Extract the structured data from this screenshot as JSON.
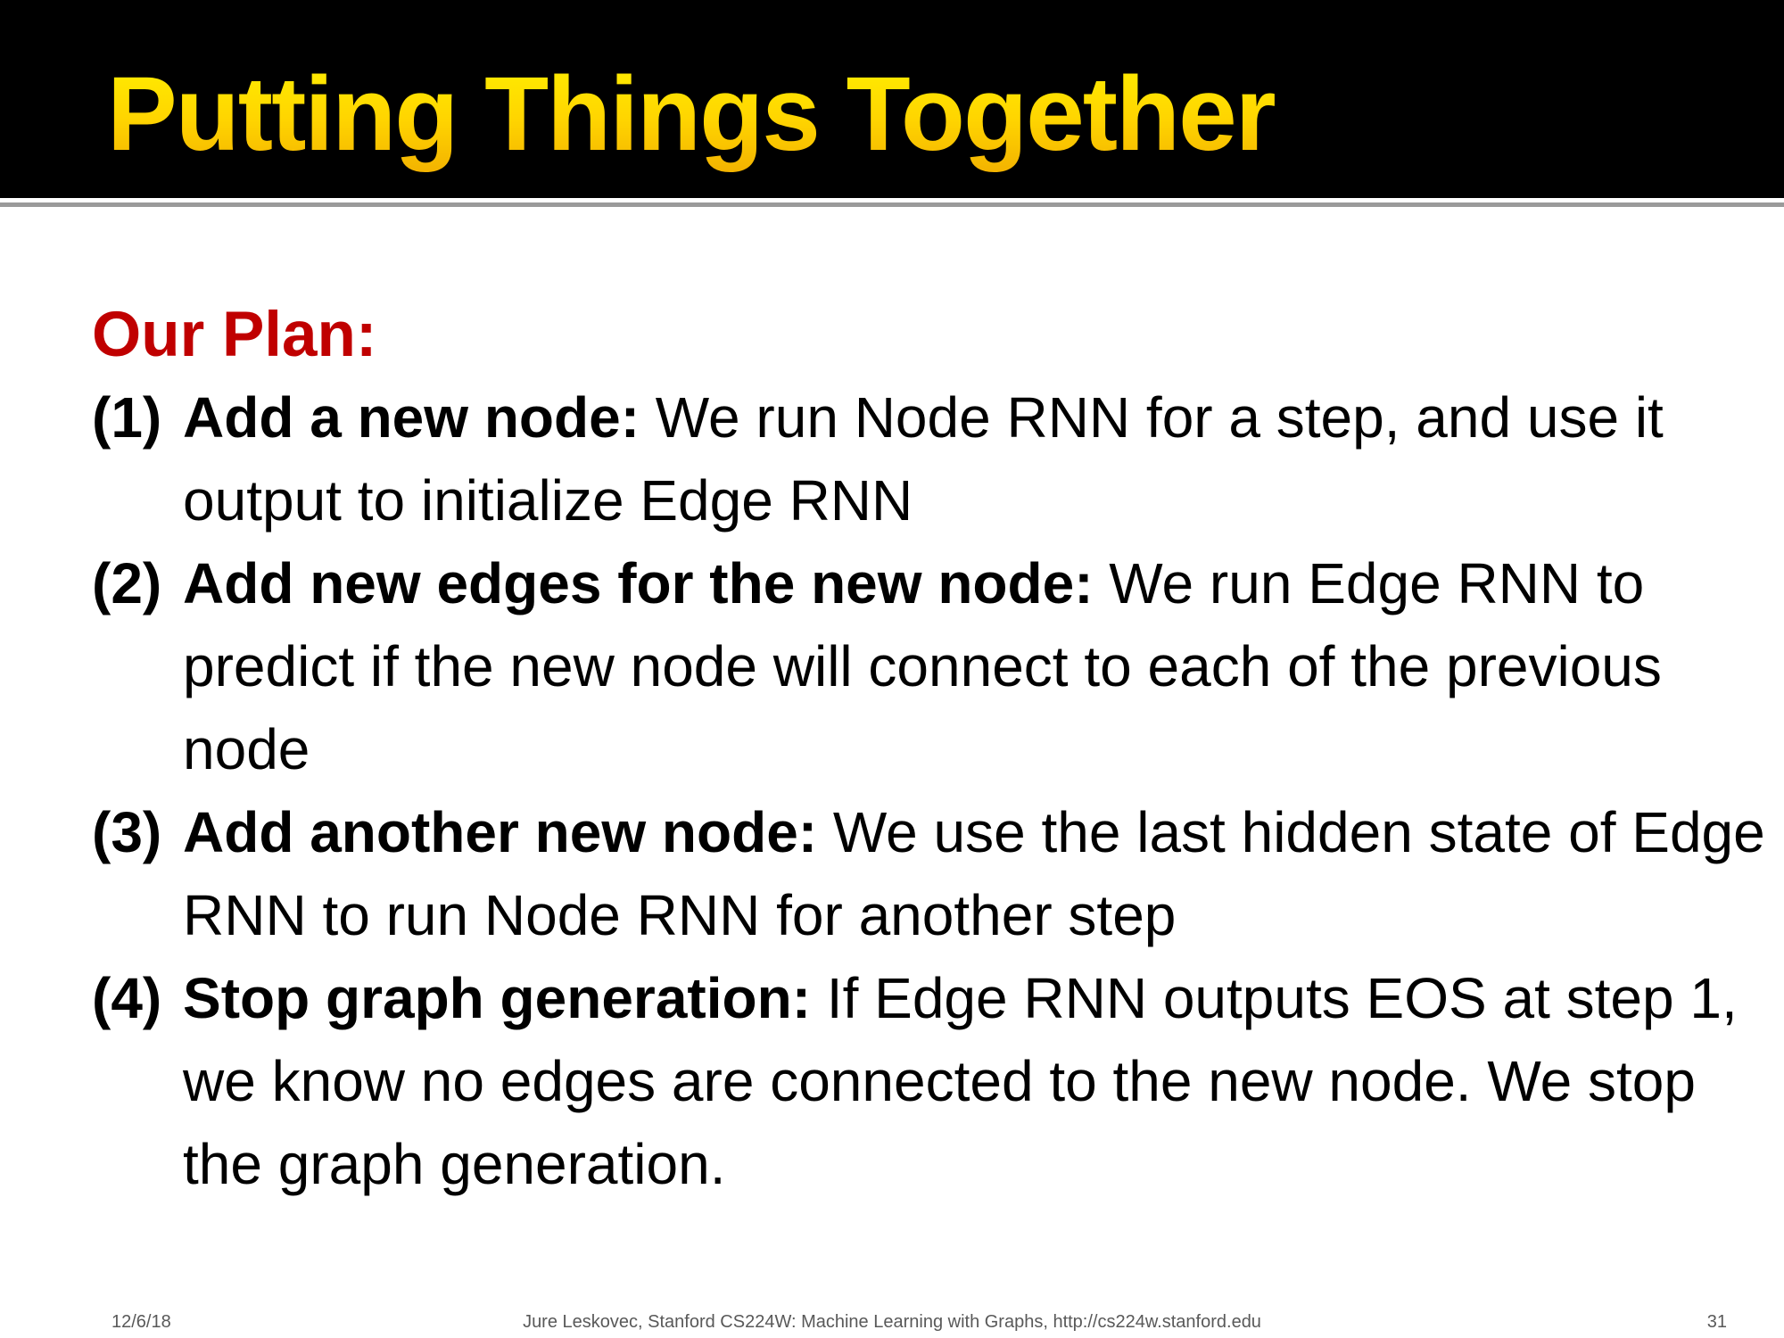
{
  "slide": {
    "title": "Putting Things Together",
    "heading": "Our Plan:",
    "steps": [
      {
        "number": "(1)",
        "lead": "Add a new node:",
        "text": " We run Node RNN for a step, and use it output to initialize Edge RNN"
      },
      {
        "number": "(2)",
        "lead": "Add new edges for the new node:",
        "text": " We run Edge RNN to predict if the new node will connect to each of the previous node"
      },
      {
        "number": "(3)",
        "lead": "Add another new node:",
        "text": " We use the last hidden state of Edge RNN to run Node RNN for another step"
      },
      {
        "number": "(4)",
        "lead": "Stop graph generation:",
        "text": " If Edge RNN outputs EOS at step 1, we know no edges are connected to the new node. We stop the graph generation."
      }
    ]
  },
  "footer": {
    "date": "12/6/18",
    "credit": "Jure Leskovec, Stanford CS224W: Machine Learning with Graphs, http://cs224w.stanford.edu",
    "page_number": "31"
  },
  "colors": {
    "title_bar": "#000000",
    "title_text": "#ffd700",
    "heading": "#c00000",
    "body_text": "#000000",
    "footer_text": "#595959"
  }
}
